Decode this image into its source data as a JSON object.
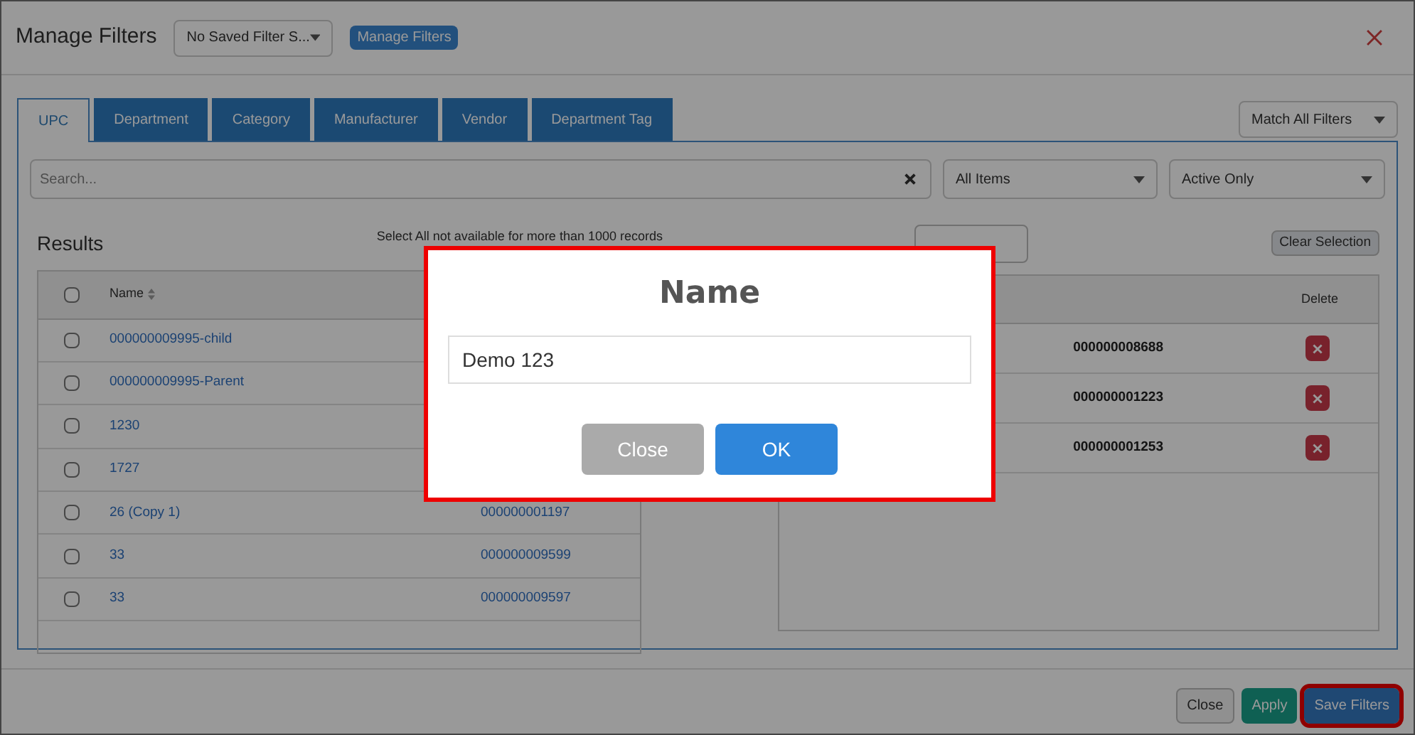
{
  "header": {
    "title": "Manage Filters",
    "saved_filter": "No Saved Filter S...",
    "manage_button": "Manage Filters"
  },
  "tabs": [
    {
      "label": "UPC",
      "selected": true
    },
    {
      "label": "Department",
      "selected": false
    },
    {
      "label": "Category",
      "selected": false
    },
    {
      "label": "Manufacturer",
      "selected": false
    },
    {
      "label": "Vendor",
      "selected": false
    },
    {
      "label": "Department Tag",
      "selected": false
    }
  ],
  "match_select": "Match All Filters",
  "search": {
    "placeholder": "Search..."
  },
  "items_select": "All Items",
  "status_select": "Active Only",
  "results": {
    "title": "Results",
    "all_checked": false,
    "note": "Select All not available for more than 1000 records",
    "name_column": "Name",
    "rows": [
      {
        "name": "000000009995-child",
        "code": "",
        "checked": false
      },
      {
        "name": "000000009995-Parent",
        "code": "",
        "checked": false
      },
      {
        "name": "1230",
        "code": "",
        "checked": false
      },
      {
        "name": "1727",
        "code": "",
        "checked": false
      },
      {
        "name": "26 (Copy 1)",
        "code": "000000001197",
        "checked": false
      },
      {
        "name": "33",
        "code": "000000009599",
        "checked": false
      },
      {
        "name": "33",
        "code": "000000009597",
        "checked": false
      }
    ]
  },
  "selected": {
    "clear_button": "Clear Selection",
    "delete_column": "Delete",
    "rows": [
      {
        "code": "000000008688"
      },
      {
        "code": "000000001223"
      },
      {
        "code": "000000001253"
      }
    ]
  },
  "footer": {
    "buttons": [
      {
        "label": "Close",
        "kind": "default",
        "highlighted": false
      },
      {
        "label": "Apply",
        "kind": "success",
        "highlighted": false
      },
      {
        "label": "Save Filters",
        "kind": "primary",
        "highlighted": true
      }
    ]
  },
  "dialog": {
    "title": "Name",
    "value": "Demo 123",
    "buttons": [
      {
        "label": "Close",
        "kind": "secondary"
      },
      {
        "label": "OK",
        "kind": "primary"
      }
    ]
  }
}
